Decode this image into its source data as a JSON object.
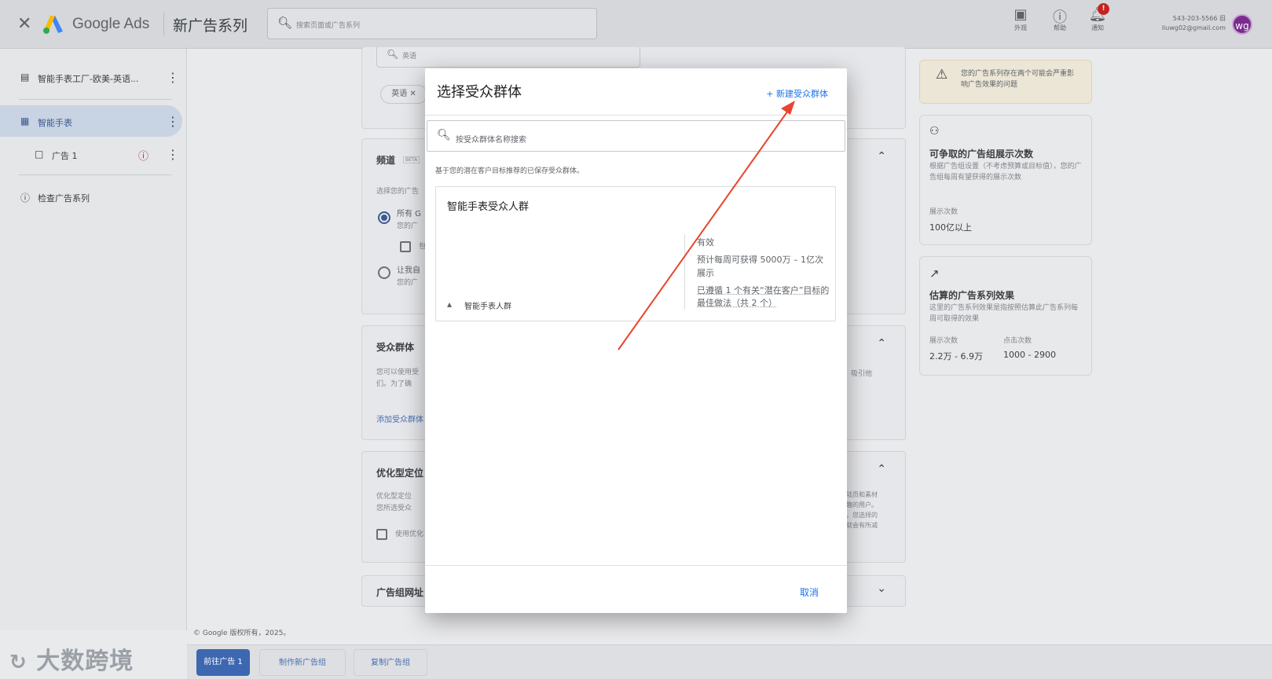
{
  "topbar": {
    "close_glyph": "✕",
    "brand": "Google Ads",
    "campaign_title": "新广告系列",
    "search_placeholder": "搜索页面或广告系列",
    "tools": [
      {
        "icon": "appearance-icon",
        "label": "外观"
      },
      {
        "icon": "help-icon",
        "label": "帮助"
      },
      {
        "icon": "notification-icon",
        "label": "通知"
      }
    ],
    "notif_count": "!",
    "account_id": "543-203-5566 旧",
    "account_email": "liuwg02@gmail.com",
    "avatar_initials": "wg"
  },
  "sidebar": {
    "items": [
      {
        "label": "智能手表工厂-欧美-英语...",
        "icon": "campaign-icon"
      },
      {
        "label": "智能手表",
        "icon": "ad-group-icon"
      },
      {
        "label": "广告 1",
        "icon": "ad-icon"
      },
      {
        "label": "检查广告系列",
        "icon": "info-icon"
      }
    ]
  },
  "main": {
    "lang_search_text": "英语",
    "lang_chip": "英语 ✕",
    "channel_header": "频道",
    "channel_badge": "BETA",
    "channel_body": "选择您的广告",
    "channel_opt1": "所有 G",
    "channel_opt1_sub": "您的广",
    "channel_opt1_check": "包",
    "channel_opt2": "让我自",
    "channel_opt2_sub": "您的广",
    "audience_header": "受众群体",
    "audience_body": "您可以使用受\n们。为了确",
    "audience_right": "吸引他",
    "audience_link": "添加受众群体",
    "optimized_header": "优化型定位",
    "optimized_body": "优化型定位\n您所选受众",
    "optimized_check": "使用优化",
    "optimized_right": "陆页和素材\n趣的用户。\n，您选择的\n就会有所减",
    "adgroup_url_header": "广告组网址"
  },
  "right_panel": {
    "warning": "您的广告系列存在两个可能会严重影响广告效果的问题",
    "card1_title": "可争取的广告组展示次数",
    "card1_desc": "根据广告组设置（不考虑预算或目标值），您的广告组每周有望获得的展示次数",
    "card1_metric_label": "展示次数",
    "card1_metric_value": "100亿以上",
    "card2_title": "估算的广告系列效果",
    "card2_desc": "这里的广告系列效果是指按照估算此广告系列每周可取得的效果",
    "card2_col1_label": "展示次数",
    "card2_col1_value": "2.2万 - 6.9万",
    "card2_col2_label": "点击次数",
    "card2_col2_value": "1000 - 2900"
  },
  "footer": {
    "copyright": "© Google 版权所有，2025。",
    "btn_next": "前往广告 1",
    "btn_new_group": "制作新广告组",
    "btn_copy_group": "复制广告组",
    "watermark": "大数跨境"
  },
  "modal": {
    "title": "选择受众群体",
    "new_audience": "+ 新建受众群体",
    "search_placeholder": "按受众群体名称搜索",
    "recommend_text": "基于您的潜在客户目标推荐的已保存受众群体。",
    "audience": {
      "name": "智能手表受众人群",
      "segment": "智能手表人群",
      "status": "有效",
      "reach": "预计每周可获得 5000万 – 1亿次展示",
      "best_practice": "已遵循 1 个有关“潜在客户”目标的最佳做法（共 2 个）"
    },
    "cancel": "取消"
  },
  "colors": {
    "accent": "#1a73e8",
    "primary_button": "#3d67b0",
    "arrow": "#e8442e",
    "warning": "#c5221f"
  }
}
